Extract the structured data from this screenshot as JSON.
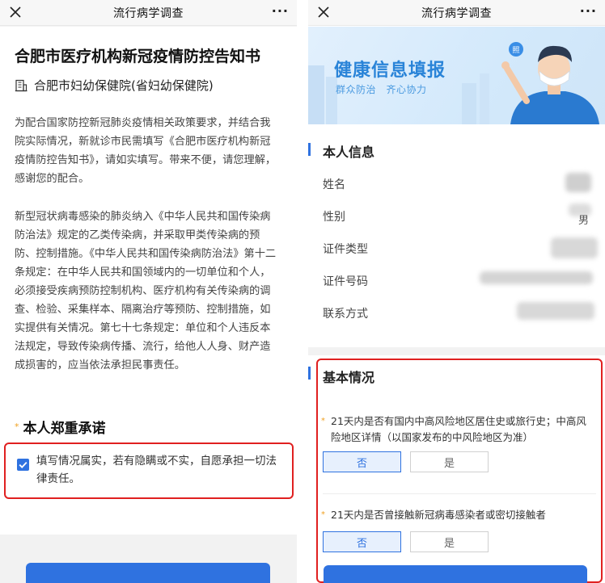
{
  "left": {
    "nav_title": "流行病学调查",
    "nav_more": "···",
    "notice_title": "合肥市医疗机构新冠疫情防控告知书",
    "org_name": "合肥市妇幼保健院(省妇幼保健院)",
    "paragraph_1": "为配合国家防控新冠肺炎疫情相关政策要求，并结合我院实际情况，新就诊市民需填写《合肥市医疗机构新冠疫情防控告知书》，请如实填写。带来不便，请您理解，感谢您的配合。",
    "paragraph_2": "新型冠状病毒感染的肺炎纳入《中华人民共和国传染病防治法》规定的乙类传染病，并采取甲类传染病的预防、控制措施。《中华人民共和国传染病防治法》第十二条规定：在中华人民共和国领域内的一切单位和个人，必须接受疾病预防控制机构、医疗机构有关传染病的调查、检验、采集样本、隔离治疗等预防、控制措施，如实提供有关情况。第七十七条规定：单位和个人违反本法规定，导致传染病传播、流行，给他人人身、财产造成损害的，应当依法承担民事责任。",
    "section_star": "*",
    "section_title": "本人郑重承诺",
    "pledge_text": "填写情况属实，若有隐瞒或不实，自愿承担一切法律责任。",
    "pledge_checked": true
  },
  "right": {
    "nav_title": "流行病学调查",
    "nav_more": "···",
    "banner_title": "健康信息填报",
    "banner_subtitle": "群众防治　齐心协力",
    "banner_badge": "照",
    "personal_section_title": "本人信息",
    "fields": [
      {
        "label": "姓名"
      },
      {
        "label": "性别",
        "value_partial": "男"
      },
      {
        "label": "证件类型"
      },
      {
        "label": "证件号码"
      },
      {
        "label": "联系方式"
      }
    ],
    "basic_section_title": "基本情况",
    "questions": [
      {
        "star": "*",
        "text": "21天内是否有国内中高风险地区居住史或旅行史；中高风险地区详情（以国家发布的中风险地区为准）",
        "options": [
          "否",
          "是"
        ],
        "selected": "否"
      },
      {
        "star": "*",
        "text": "21天内是否曾接触新冠病毒感染者或密切接触者",
        "options": [
          "否",
          "是"
        ],
        "selected": "否"
      }
    ]
  },
  "colors": {
    "accent": "#2f72e0",
    "highlight_border": "#e02020",
    "required_star": "#f0a020",
    "banner_text": "#2a84d8"
  }
}
